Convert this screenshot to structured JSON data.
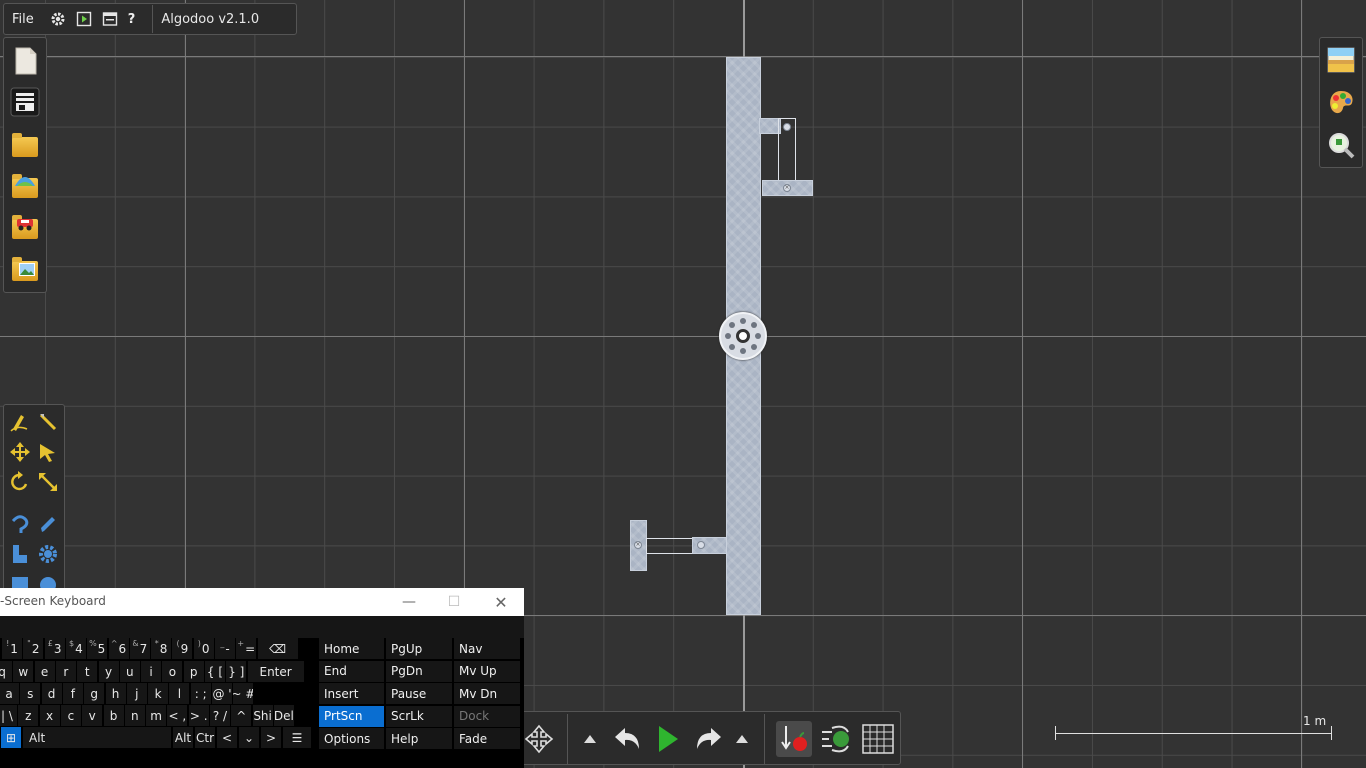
{
  "app": {
    "menu_file": "File",
    "title": "Algodoo v2.1.0",
    "menu_icons": [
      "gear-icon",
      "play-scene-icon",
      "window-icon",
      "help-icon"
    ]
  },
  "file_panel": {
    "icons": [
      "new-scene-icon",
      "scene-list-icon",
      "open-folder-icon",
      "open-online-folder-icon",
      "open-phunlet-folder-icon",
      "open-image-folder-icon"
    ]
  },
  "tools": {
    "icons": [
      "sketch-tool-icon",
      "cut-tool-icon",
      "move-tool-icon",
      "drag-tool-icon",
      "rotate-tool-icon",
      "scale-tool-icon",
      "rope-tool-icon",
      "pen-tool-icon",
      "hinge-tool-icon",
      "gear-tool-icon",
      "box-tool-icon",
      "circle-tool-icon"
    ]
  },
  "right_panel": {
    "icons": [
      "background-icon",
      "color-palette-icon",
      "zoom-view-icon"
    ]
  },
  "bottom_toolbar": {
    "icons": [
      "pan-icon",
      "up-arrow-icon",
      "undo-icon",
      "play-icon",
      "redo-icon",
      "up-arrow-icon",
      "gravity-icon",
      "air-friction-icon",
      "grid-icon"
    ]
  },
  "scale_bar": {
    "label": "1 m"
  },
  "osk": {
    "title": "On-Screen Keyboard",
    "window_controls": {
      "minimize": "—",
      "maximize": "☐",
      "close": "✕"
    },
    "row1": [
      {
        "sup": "!",
        "k": "1"
      },
      {
        "sup": "\"",
        "k": "2"
      },
      {
        "sup": "£",
        "k": "3"
      },
      {
        "sup": "$",
        "k": "4"
      },
      {
        "sup": "%",
        "k": "5"
      },
      {
        "sup": "^",
        "k": "6"
      },
      {
        "sup": "&",
        "k": "7"
      },
      {
        "sup": "*",
        "k": "8"
      },
      {
        "sup": "(",
        "k": "9"
      },
      {
        "sup": ")",
        "k": "0"
      },
      {
        "sup": "_",
        "k": "-"
      },
      {
        "sup": "+",
        "k": "="
      }
    ],
    "backspace": "⌫",
    "row2": [
      "q",
      "w",
      "e",
      "r",
      "t",
      "y",
      "u",
      "i",
      "o",
      "p",
      "{ [",
      "} ]"
    ],
    "enter": "Enter",
    "row3": [
      "a",
      "s",
      "d",
      "f",
      "g",
      "h",
      "j",
      "k",
      "l",
      ": ;",
      "@ '",
      "~ #"
    ],
    "row4": [
      "| \\",
      "z",
      "x",
      "c",
      "v",
      "b",
      "n",
      "m",
      "< ,",
      "> .",
      "? /",
      "^",
      "Shi",
      "Del"
    ],
    "row5": {
      "win": "⊞",
      "alt": "Alt",
      "altgr": "Alt",
      "ctrl": "Ctr",
      "left": "<",
      "down": "⌄",
      "right": ">",
      "menu": "☰"
    },
    "nav": [
      [
        "Home",
        "PgUp",
        "Nav"
      ],
      [
        "End",
        "PgDn",
        "Mv Up"
      ],
      [
        "Insert",
        "Pause",
        "Mv Dn"
      ],
      [
        "PrtScn",
        "ScrLk",
        "Dock"
      ],
      [
        "Options",
        "Help",
        "Fade"
      ]
    ],
    "active_key": "PrtScn",
    "disabled_key": "Dock"
  }
}
